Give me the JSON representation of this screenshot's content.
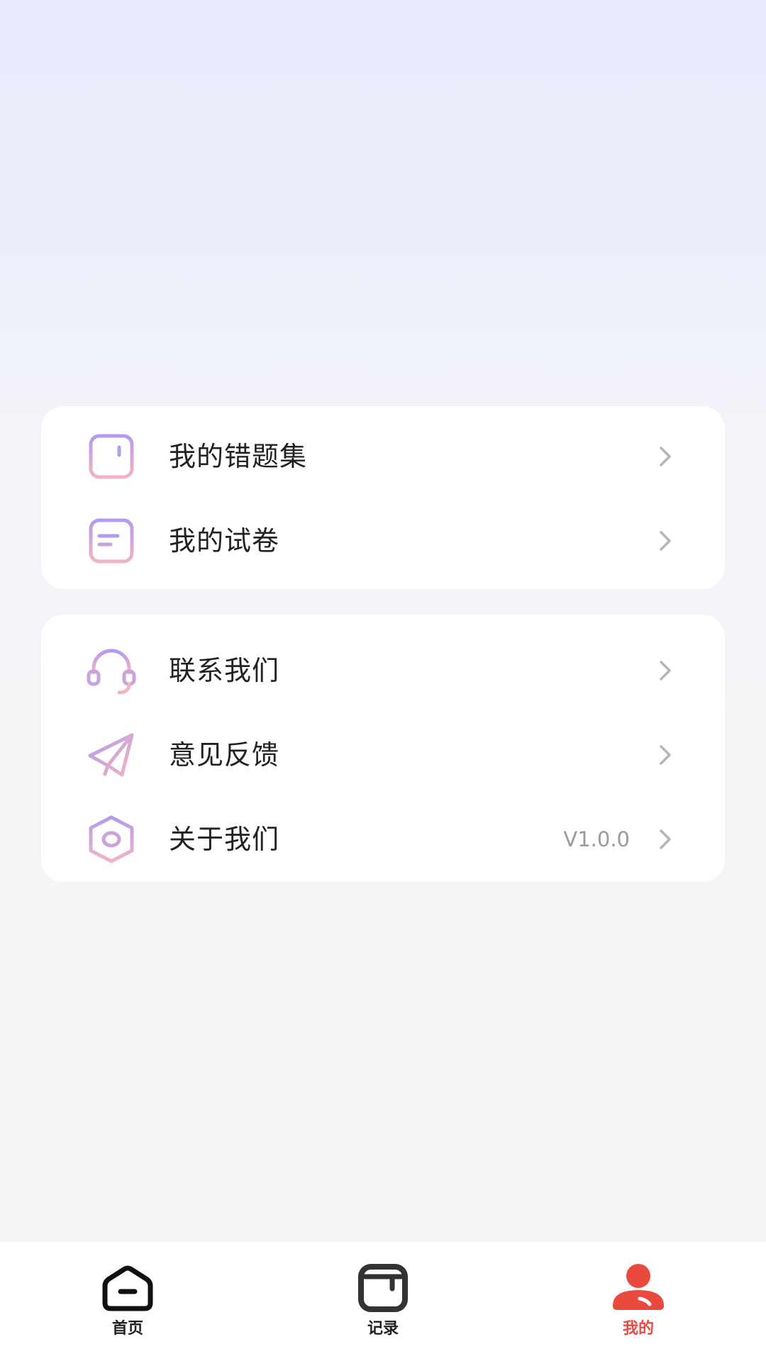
{
  "menu_group_1": {
    "items": [
      {
        "label": "我的错题集",
        "icon": "wrong-question-folder-icon"
      },
      {
        "label": "我的试卷",
        "icon": "exam-paper-icon"
      }
    ]
  },
  "menu_group_2": {
    "items": [
      {
        "label": "联系我们",
        "icon": "headset-icon"
      },
      {
        "label": "意见反馈",
        "icon": "paper-plane-icon"
      },
      {
        "label": "关于我们",
        "icon": "hexagon-eye-icon",
        "value": "V1.0.0"
      }
    ]
  },
  "tabbar": {
    "tabs": [
      {
        "label": "首页",
        "icon": "home-icon"
      },
      {
        "label": "记录",
        "icon": "record-icon"
      },
      {
        "label": "我的",
        "icon": "profile-icon",
        "active": true
      }
    ]
  },
  "colors": {
    "accent": "#ea4a3e",
    "icon_gradient_start": "#b39bf0",
    "icon_gradient_end": "#f2b3c4"
  }
}
